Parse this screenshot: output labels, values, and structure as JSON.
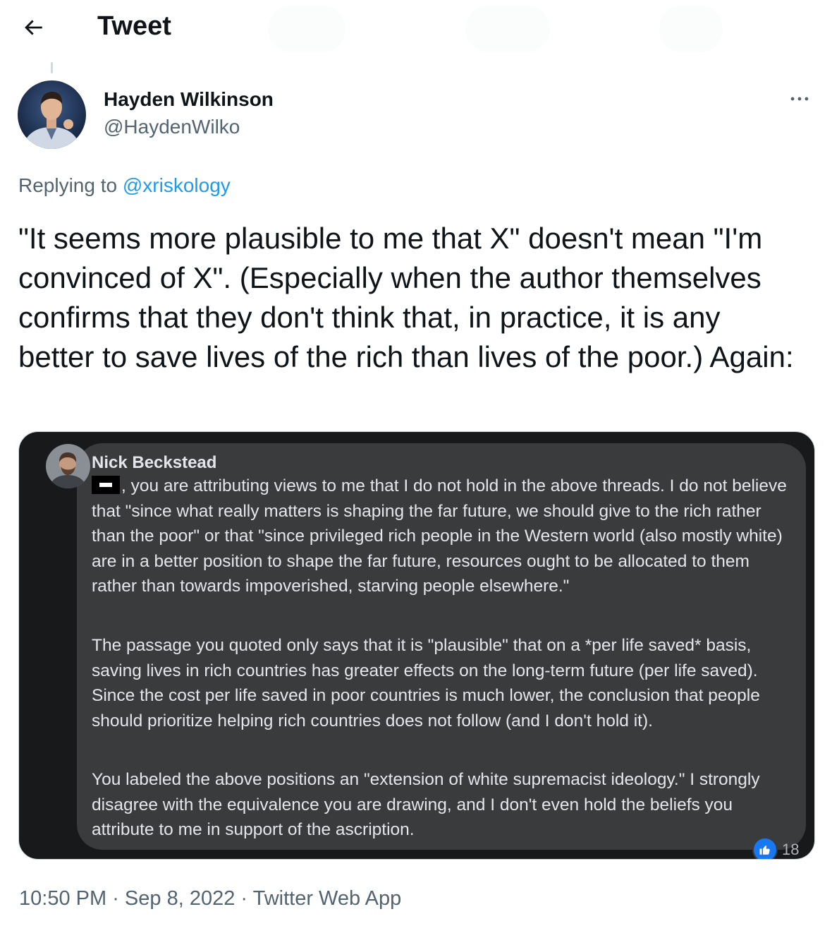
{
  "header": {
    "title": "Tweet",
    "back_icon": "arrow-left-icon"
  },
  "author": {
    "name": "Hayden Wilkinson",
    "handle": "@HaydenWilko",
    "more_icon": "more-horizontal-icon"
  },
  "replying": {
    "prefix": "Replying to",
    "mention": "@xriskology"
  },
  "tweet": {
    "text": "\"It seems more plausible to me that X\" doesn't mean \"I'm convinced of X\". (Especially when the author themselves confirms that they don't think that, in practice, it is any better to save lives of the rich than lives of the poor.) Again:"
  },
  "media": {
    "commenter": "Nick Beckstead",
    "paragraph_1": ", you are attributing views to me that I do not hold in the above threads. I do not believe that \"since what really matters is shaping the far future, we should give to the rich rather than the poor\" or that \"since privileged rich people in the Western world (also mostly white) are in a better position to shape the far future, resources ought to be allocated to them rather than towards impoverished, starving people elsewhere.\"",
    "paragraph_2": "The passage you quoted only says that it is \"plausible\" that on a *per life saved* basis, saving lives in rich countries has greater effects on the long-term future (per life saved). Since the cost per life saved in poor countries is much lower, the conclusion that people should prioritize helping rich countries does not follow (and I don't hold it).",
    "paragraph_3": "You labeled the above positions an \"extension of white supremacist ideology.\" I strongly disagree with the equivalence you are drawing, and I don't even hold the beliefs you attribute to me in support of the ascription.",
    "reaction_count": "18",
    "reaction_icon": "thumbs-up-icon",
    "colors": {
      "background": "#18191a",
      "bubble": "#3a3b3c",
      "text": "#e4e6eb",
      "like": "#1877f2"
    }
  },
  "meta": {
    "time": "10:50 PM",
    "separator": " · ",
    "date": "Sep 8, 2022",
    "source": "Twitter Web App"
  },
  "colors": {
    "text": "#0f1419",
    "secondary": "#536471",
    "accent": "#1d9bf0"
  }
}
